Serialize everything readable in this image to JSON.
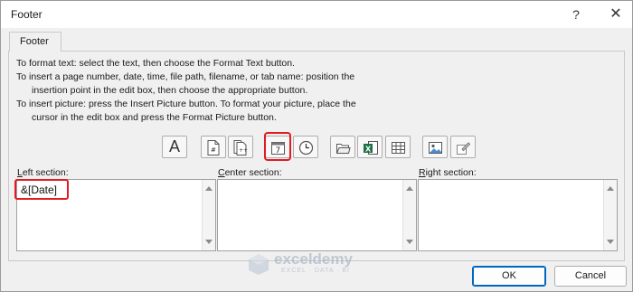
{
  "window": {
    "title": "Footer",
    "help_label": "?",
    "close_label": "✕"
  },
  "tab": {
    "label": "Footer"
  },
  "instructions": [
    "To format text:  select the text, then choose the Format Text button.",
    "To insert a page number, date, time, file path, filename, or tab name:  position the",
    "insertion point in the edit box, then choose the appropriate button.",
    "To insert picture: press the Insert Picture button.  To format your picture, place the",
    "cursor in the edit box and press the Format Picture button."
  ],
  "toolbar": {
    "buttons": [
      {
        "name": "format-text",
        "icon": "format-text-icon"
      },
      {
        "name": "insert-page-number",
        "icon": "page-number-icon"
      },
      {
        "name": "insert-number-of-pages",
        "icon": "number-of-pages-icon"
      },
      {
        "name": "insert-date",
        "icon": "calendar-icon",
        "highlighted": true
      },
      {
        "name": "insert-time",
        "icon": "clock-icon"
      },
      {
        "name": "insert-file-path",
        "icon": "folder-icon"
      },
      {
        "name": "insert-file-name",
        "icon": "excel-file-icon"
      },
      {
        "name": "insert-sheet-name",
        "icon": "sheet-tab-icon"
      },
      {
        "name": "insert-picture",
        "icon": "picture-icon"
      },
      {
        "name": "format-picture",
        "icon": "format-picture-icon"
      }
    ],
    "format_text_glyph": "A",
    "date_glyph": "7"
  },
  "sections": {
    "left": {
      "label_pre": "",
      "label_key": "L",
      "label_post": "eft section:",
      "value": "&[Date]"
    },
    "center": {
      "label_pre": "",
      "label_key": "C",
      "label_post": "enter section:",
      "value": ""
    },
    "right": {
      "label_pre": "",
      "label_key": "R",
      "label_post": "ight section:",
      "value": ""
    }
  },
  "buttons": {
    "ok": "OK",
    "cancel": "Cancel"
  },
  "watermark": {
    "name": "exceldemy",
    "tagline": "EXCEL · DATA · BI"
  },
  "colors": {
    "highlight": "#e21b23",
    "accent": "#0067c0",
    "excel_green": "#1d7044"
  }
}
